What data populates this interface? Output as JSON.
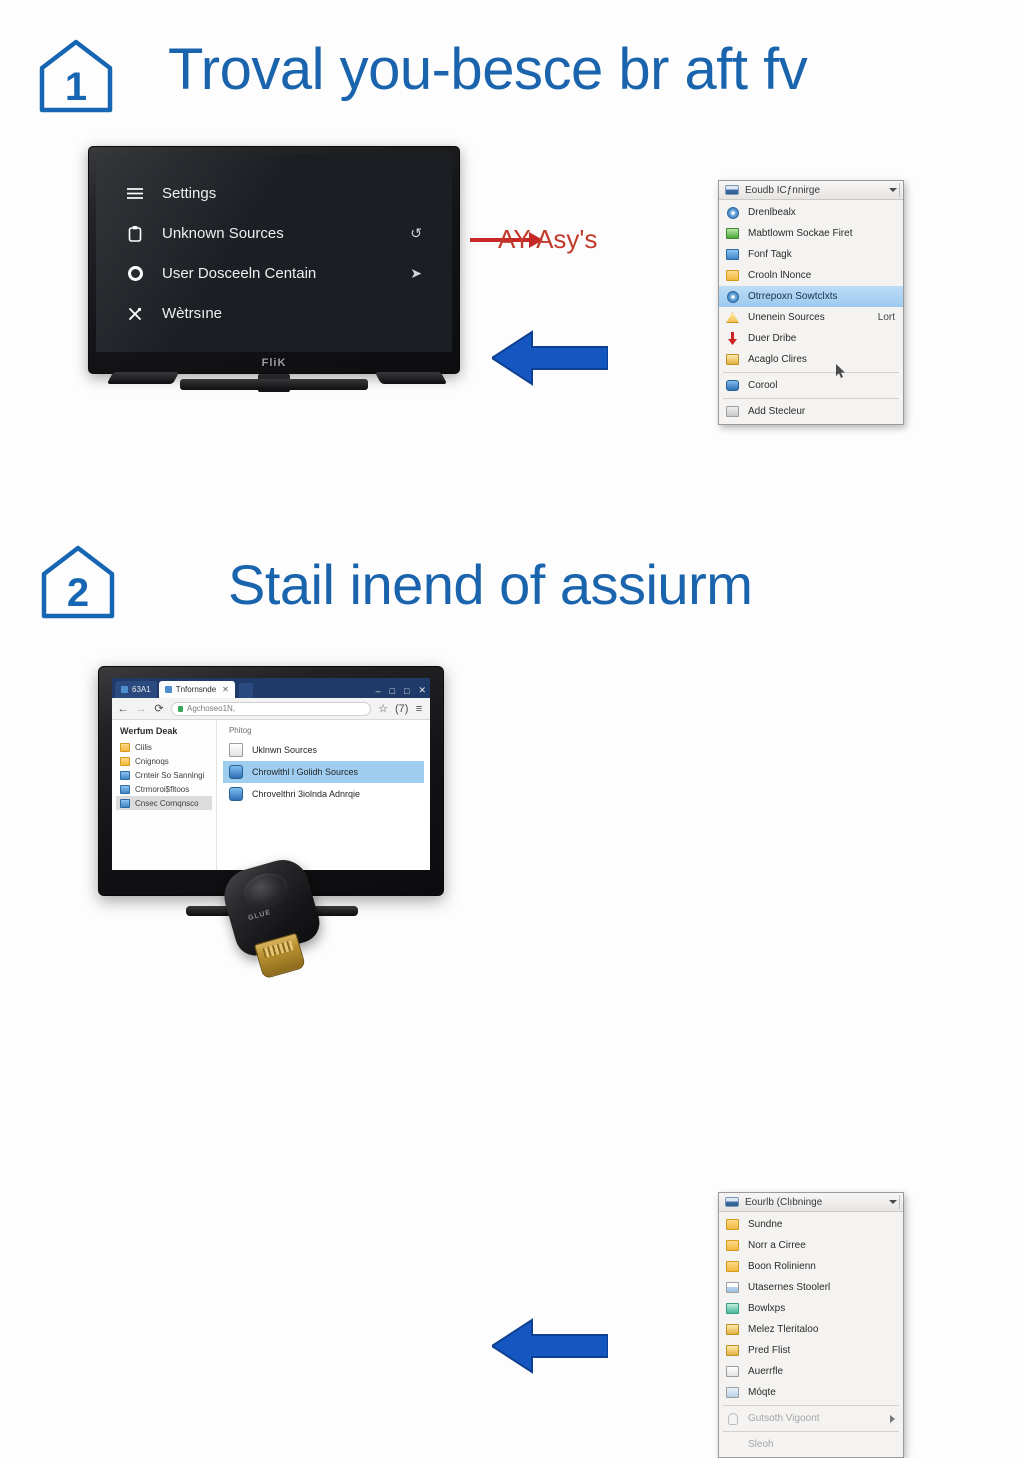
{
  "page": {
    "background": "#fdfdfd",
    "accent_blue": "#1a64ad",
    "arrow_blue": "#1557c0",
    "red": "#c62828"
  },
  "steps": [
    {
      "number": "1",
      "title": "Troval you-besce br aft fv",
      "tv": {
        "brand": "FliK",
        "menu": [
          {
            "icon": "hamburger-icon",
            "label": "Settings",
            "end": ""
          },
          {
            "icon": "clipboard-icon",
            "label": "Unknown Sources",
            "end": "↺"
          },
          {
            "icon": "circle-icon",
            "label": "User Dosceeln Centain",
            "end": "➤"
          },
          {
            "icon": "tools-icon",
            "label": "Wètrsıne",
            "end": ""
          }
        ]
      },
      "callout": {
        "label": "AY Asy's",
        "color": "#c0392b"
      },
      "arrow": {
        "direction": "left",
        "color": "#1557c0"
      },
      "context_menu": {
        "header": {
          "label": "Eoudb ICƒnnirge",
          "caret": "▾"
        },
        "items": [
          {
            "icon": "disc-icon",
            "label": "Drenlbealx",
            "accel": "",
            "state": "normal",
            "submenu": false
          },
          {
            "icon": "green-puzzle-icon",
            "label": "Mabtlowm Sockae Firet",
            "accel": "",
            "state": "normal",
            "submenu": false
          },
          {
            "icon": "blue-folder-icon",
            "label": "Fonf Tagk",
            "accel": "",
            "state": "normal",
            "submenu": false
          },
          {
            "icon": "gold-folder-icon",
            "label": "Crooln lNonce",
            "accel": "",
            "state": "normal",
            "submenu": false
          },
          {
            "icon": "disc-icon",
            "label": "Otrrepoxn Sowtclxts",
            "accel": "",
            "state": "selected",
            "submenu": false
          },
          {
            "icon": "warning-icon",
            "label": "Unenein Sources",
            "accel": "Lort",
            "state": "normal",
            "submenu": false
          },
          {
            "icon": "red-arrow-icon",
            "label": "Duer Dribe",
            "accel": "",
            "state": "normal",
            "submenu": false
          },
          {
            "icon": "gold-folder-icon",
            "label": "Acaglo Clires",
            "accel": "",
            "state": "normal",
            "submenu": false
          },
          {
            "icon": "blue-puzzle-icon",
            "label": "Corool",
            "accel": "",
            "state": "normal",
            "submenu": false
          },
          {
            "icon": "grey-icon",
            "label": "Add Stecleur",
            "accel": "",
            "state": "normal",
            "submenu": false
          }
        ]
      }
    },
    {
      "number": "2",
      "title": "Stail inend of assiurm",
      "browser": {
        "tabs": [
          {
            "label": "63A1",
            "active": false
          },
          {
            "label": "Tnfornsnde",
            "active": true
          }
        ],
        "window_buttons": [
          "–",
          "□",
          "□",
          "✕"
        ],
        "toolbar": {
          "back": "←",
          "forward": "→",
          "reload": "⟳",
          "address_value": "Agchoseo1N,",
          "star": "☆",
          "profile": "(7)",
          "menu": "≡"
        },
        "sidebar": {
          "title": "Werfum Deak",
          "items": [
            {
              "icon": "folder-icon",
              "label": "Ciilis",
              "selected": false
            },
            {
              "icon": "folder-icon",
              "label": "Cnignoqs",
              "selected": false
            },
            {
              "icon": "drive-icon",
              "label": "Crnteir So Sannlngi",
              "selected": false
            },
            {
              "icon": "drive-icon",
              "label": "Ctrmoroi$fltoos",
              "selected": false
            },
            {
              "icon": "drive-icon",
              "label": "Cnsec Cornqnsco",
              "selected": true
            }
          ]
        },
        "content": {
          "title": "Phitog",
          "files": [
            {
              "icon": "file-icon",
              "label": "Uklnwn Sources",
              "selected": false
            },
            {
              "icon": "shield-icon",
              "label": "Chrowlthl l Golidh Sources",
              "selected": true
            },
            {
              "icon": "shield-icon",
              "label": "Chrovelthri 3iolnda Adnrqie",
              "selected": false
            }
          ]
        }
      },
      "dongle": {
        "brand": "GLUE"
      },
      "arrow": {
        "direction": "left",
        "color": "#1557c0"
      },
      "context_menu": {
        "header": {
          "label": "Eourlb (Clıbninge",
          "caret": "▾"
        },
        "items": [
          {
            "icon": "gold-folder-icon",
            "label": "Sundne",
            "accel": "",
            "state": "normal",
            "submenu": false
          },
          {
            "icon": "gold-folder-icon",
            "label": "Norr a Cirree",
            "accel": "",
            "state": "normal",
            "submenu": false
          },
          {
            "icon": "gold-folder-icon",
            "label": "Boon Rolinienn",
            "accel": "",
            "state": "normal",
            "submenu": false
          },
          {
            "icon": "window-icon",
            "label": "Utasernes Stoolerl",
            "accel": "",
            "state": "normal",
            "submenu": false
          },
          {
            "icon": "teal-icon",
            "label": "Bowlxps",
            "accel": "",
            "state": "normal",
            "submenu": false
          },
          {
            "icon": "gold-icon",
            "label": "Melez Tleritaloo",
            "accel": "",
            "state": "normal",
            "submenu": false
          },
          {
            "icon": "gold-icon",
            "label": "Pred Flist",
            "accel": "",
            "state": "normal",
            "submenu": false
          },
          {
            "icon": "doc-icon",
            "label": "Auerrfle",
            "accel": "",
            "state": "normal",
            "submenu": false
          },
          {
            "icon": "monitor-icon",
            "label": "Móqte",
            "accel": "",
            "state": "normal",
            "submenu": false
          },
          {
            "icon": "clip-icon",
            "label": "Gutsoth Vigoont",
            "accel": "",
            "state": "disabled",
            "submenu": true
          },
          {
            "icon": "none-icon",
            "label": "Sleoh",
            "accel": "",
            "state": "disabled",
            "submenu": false
          }
        ]
      }
    }
  ]
}
